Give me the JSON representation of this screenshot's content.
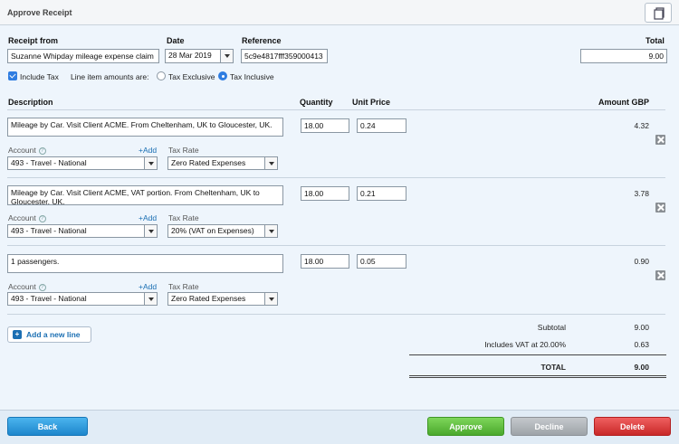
{
  "window": {
    "title": "Approve Receipt",
    "popout_icon": "popout-window-icon"
  },
  "header": {
    "receipt_from_label": "Receipt from",
    "receipt_from_value": "Suzanne Whipday mileage expense claim",
    "date_label": "Date",
    "date_value": "28 Mar 2019",
    "reference_label": "Reference",
    "reference_value": "5c9e4817fff359000413",
    "total_label": "Total",
    "total_value": "9.00",
    "include_tax_label": "Include Tax",
    "line_item_label": "Line item amounts are:",
    "tax_exclusive_label": "Tax Exclusive",
    "tax_inclusive_label": "Tax Inclusive"
  },
  "columns": {
    "description": "Description",
    "quantity": "Quantity",
    "unit_price": "Unit Price",
    "amount": "Amount GBP"
  },
  "line_labels": {
    "account": "Account",
    "add": "+Add",
    "tax_rate": "Tax Rate"
  },
  "lines": [
    {
      "description": "Mileage by Car. Visit Client ACME.  From Cheltenham, UK to Gloucester, UK.",
      "quantity": "18.00",
      "unit_price": "0.24",
      "amount": "4.32",
      "account": "493 - Travel - National",
      "tax_rate": "Zero Rated Expenses"
    },
    {
      "description": "Mileage by Car. Visit Client ACME, VAT portion.  From Cheltenham, UK to Gloucester, UK.",
      "quantity": "18.00",
      "unit_price": "0.21",
      "amount": "3.78",
      "account": "493 - Travel - National",
      "tax_rate": "20% (VAT on Expenses)"
    },
    {
      "description": "1 passengers.",
      "quantity": "18.00",
      "unit_price": "0.05",
      "amount": "0.90",
      "account": "493 - Travel - National",
      "tax_rate": "Zero Rated Expenses"
    }
  ],
  "add_line_label": "Add a new line",
  "summary": {
    "subtotal_label": "Subtotal",
    "subtotal_value": "9.00",
    "vat_label": "Includes VAT at 20.00%",
    "vat_value": "0.63",
    "total_label": "TOTAL",
    "total_value": "9.00"
  },
  "footer": {
    "back_label": "Back",
    "approve_label": "Approve",
    "decline_label": "Decline",
    "delete_label": "Delete"
  }
}
